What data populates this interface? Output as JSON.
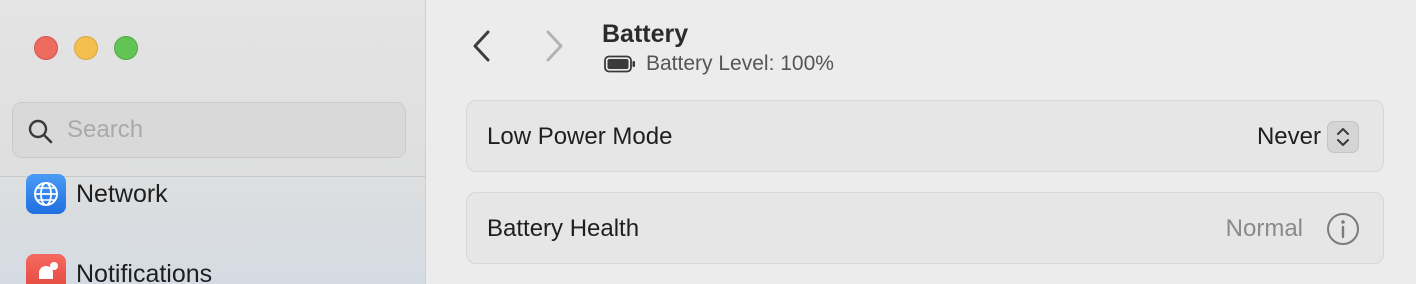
{
  "window": {
    "controls": [
      "close",
      "minimize",
      "maximize"
    ]
  },
  "sidebar": {
    "search": {
      "placeholder": "Search",
      "value": ""
    },
    "items": [
      {
        "label": "Network",
        "icon": "globe-icon"
      },
      {
        "label": "Notifications",
        "icon": "bell-icon"
      }
    ]
  },
  "header": {
    "title": "Battery",
    "subtitle": "Battery Level: 100%",
    "battery_level": 1.0
  },
  "settings": {
    "low_power": {
      "label": "Low Power Mode",
      "value": "Never"
    },
    "health": {
      "label": "Battery Health",
      "value": "Normal"
    }
  },
  "colors": {
    "close": "#ed6a5e",
    "minimize": "#f5bf4f",
    "maximize": "#61c454",
    "network_icon": "#2f80ed",
    "notifications_icon": "#e9453c"
  }
}
